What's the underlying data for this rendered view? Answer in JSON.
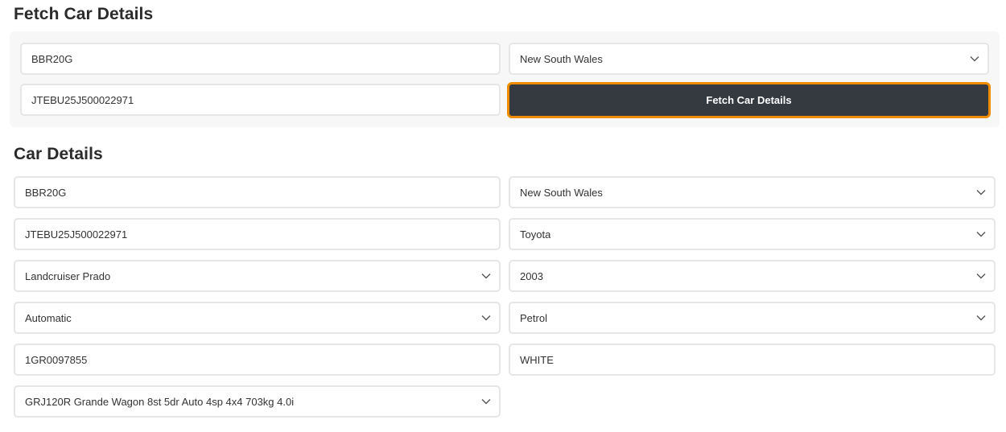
{
  "fetch_section": {
    "title": "Fetch Car Details",
    "rego_value": "BBR20G",
    "state_value": "New South Wales",
    "vin_value": "JTEBU25J500022971",
    "button_label": "Fetch Car Details"
  },
  "details_section": {
    "title": "Car Details",
    "rego": "BBR20G",
    "state": "New South Wales",
    "vin": "JTEBU25J500022971",
    "make": "Toyota",
    "model": "Landcruiser Prado",
    "year": "2003",
    "transmission": "Automatic",
    "fuel": "Petrol",
    "engine_number": "1GR0097855",
    "colour": "WHITE",
    "variant": "GRJ120R Grande Wagon 8st 5dr Auto 4sp 4x4 703kg 4.0i"
  },
  "colors": {
    "button_bg": "#343a40",
    "button_border": "#f08c00",
    "panel_bg": "#f7f7f7",
    "field_border": "#e6e6e6"
  },
  "icons": {
    "dropdown": "chevron-down-icon"
  }
}
